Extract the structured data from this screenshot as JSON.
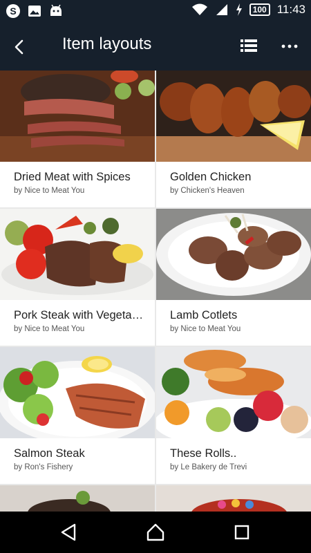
{
  "status_bar": {
    "notification_icons": [
      "skype-icon",
      "image-icon",
      "android-icon"
    ],
    "system_icons": [
      "wifi-icon",
      "signal-icon",
      "charging-icon"
    ],
    "battery": "100",
    "time": "11:43"
  },
  "app_bar": {
    "title": "Item layouts",
    "back_icon": "back-arrow-icon",
    "view_icon": "list-view-icon",
    "more_icon": "more-icon",
    "background": "#16202c"
  },
  "items": [
    {
      "name": "Dried Meat with Spices",
      "by": "by Nice to Meat You"
    },
    {
      "name": "Golden Chicken",
      "by": "by Chicken's Heaven"
    },
    {
      "name": "Pork Steak with Vegetables",
      "by": "by Nice to Meat You"
    },
    {
      "name": "Lamb Cotlets",
      "by": "by Nice to Meat You"
    },
    {
      "name": "Salmon Steak",
      "by": "by Ron's Fishery"
    },
    {
      "name": "These Rolls..",
      "by": "by Le Bakery de Trevi"
    }
  ],
  "nav_bar": {
    "back_icon": "nav-back-icon",
    "home_icon": "nav-home-icon",
    "recents_icon": "nav-recents-icon"
  }
}
